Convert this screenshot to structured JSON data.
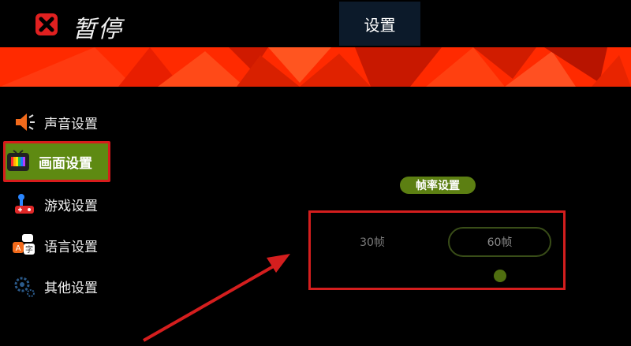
{
  "header": {
    "title": "暂停",
    "active_tab": "设置"
  },
  "sidebar": {
    "items": [
      {
        "label": "声音设置",
        "icon": "speaker-icon"
      },
      {
        "label": "画面设置",
        "icon": "tv-icon",
        "active": true
      },
      {
        "label": "游戏设置",
        "icon": "game-controller-icon"
      },
      {
        "label": "语言设置",
        "icon": "language-characters-icon"
      },
      {
        "label": "其他设置",
        "icon": "gear-icon"
      }
    ]
  },
  "frame_rate": {
    "section_label": "帧率设置",
    "options": [
      "30帧",
      "60帧"
    ],
    "selected": "60帧"
  },
  "colors": {
    "banner": "#ff2a00",
    "active_green": "#5e8a12",
    "highlight_red": "#d41e1e",
    "tab_bg": "#0c1a2a"
  }
}
